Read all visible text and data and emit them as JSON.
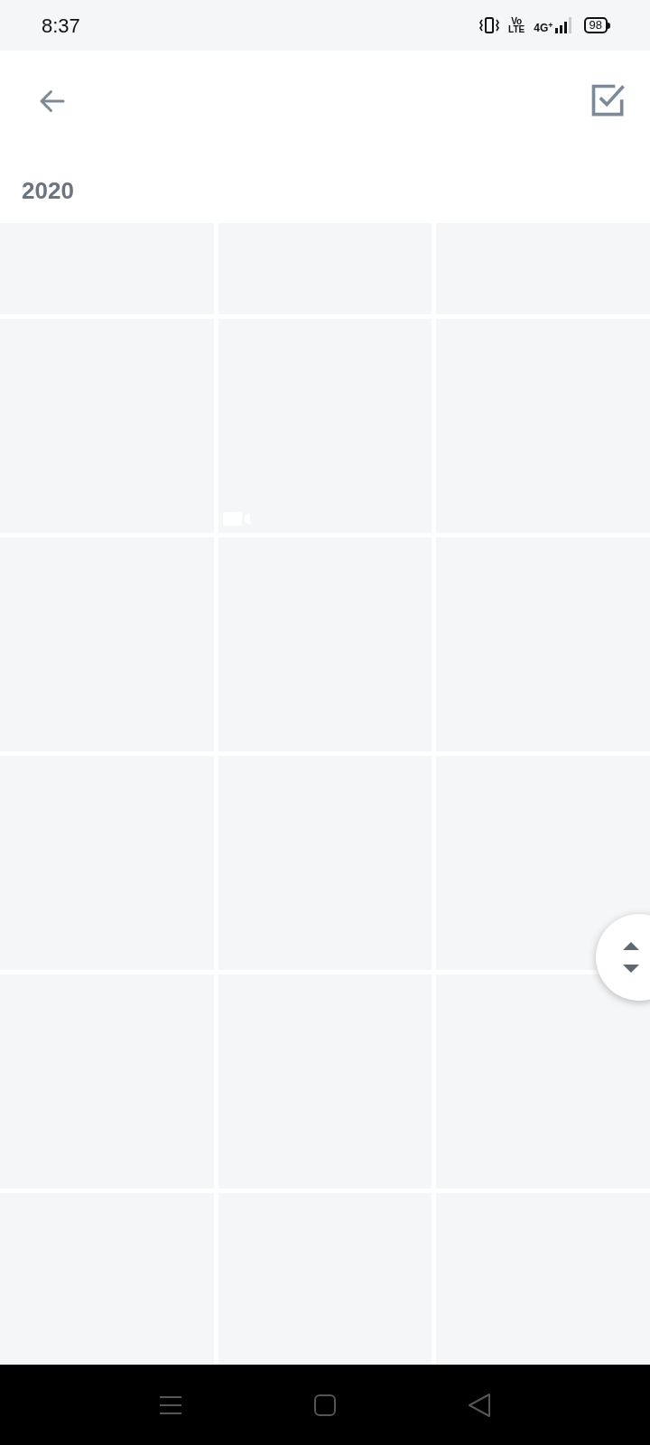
{
  "status_bar": {
    "time": "8:37",
    "volte_top": "Vo",
    "volte_bottom": "LTE",
    "network": "4G",
    "network_plus": "+",
    "battery": "98"
  },
  "section": {
    "year": "2020"
  },
  "thumbnails": [
    {
      "kind": "photo"
    },
    {
      "kind": "photo"
    },
    {
      "kind": "photo"
    },
    {
      "kind": "photo"
    },
    {
      "kind": "video"
    },
    {
      "kind": "photo"
    },
    {
      "kind": "photo"
    },
    {
      "kind": "photo"
    },
    {
      "kind": "photo"
    },
    {
      "kind": "photo"
    },
    {
      "kind": "photo"
    },
    {
      "kind": "photo"
    },
    {
      "kind": "photo"
    },
    {
      "kind": "photo"
    },
    {
      "kind": "photo"
    },
    {
      "kind": "photo"
    },
    {
      "kind": "photo"
    },
    {
      "kind": "photo"
    }
  ]
}
